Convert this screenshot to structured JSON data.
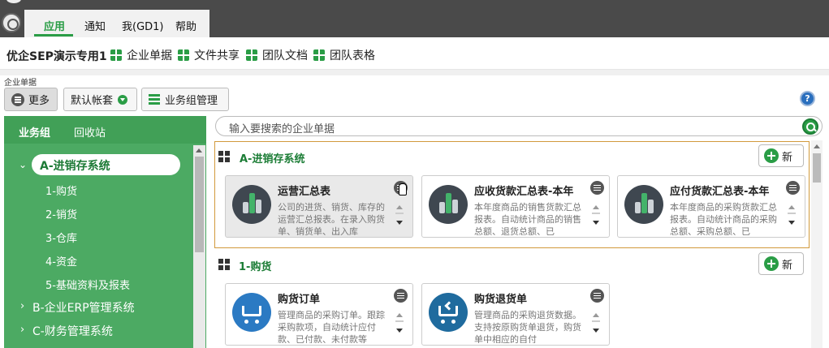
{
  "menu": {
    "items": [
      "应用",
      "通知",
      "我(GD1)",
      "帮助"
    ]
  },
  "workspace": {
    "title": "优企SEP演示专用1",
    "quick": [
      "企业单据",
      "文件共享",
      "团队文档",
      "团队表格"
    ]
  },
  "toolbar": {
    "breadcrumb": "企业单据",
    "more": "更多",
    "account": "默认帐套",
    "group_manage": "业务组管理",
    "help": "?"
  },
  "sidebar": {
    "tabs": [
      "业务组",
      "回收站"
    ],
    "selected": "A-进销存系统",
    "children": [
      "1-购货",
      "2-销货",
      "3-仓库",
      "4-资金",
      "5-基础资料及报表"
    ],
    "groups": [
      "B-企业ERP管理系统",
      "C-财务管理系统"
    ]
  },
  "search": {
    "placeholder": "输入要搜索的企业单据"
  },
  "sections": [
    {
      "title": "A-进销存系统",
      "new_label": "新",
      "cards": [
        {
          "title": "运营汇总表",
          "desc": "公司的进货、销货、库存的运营汇总报表。在录入购货单、销货单、出入库"
        },
        {
          "title": "应收货款汇总表-本年",
          "desc": "本年度商品的销售货款汇总报表。自动统计商品的销售总额、退货总额、已"
        },
        {
          "title": "应付货款汇总表-本年",
          "desc": "本年度商品的采购货款汇总报表。自动统计商品的采购总额、采购总额、已"
        }
      ]
    },
    {
      "title": "1-购货",
      "new_label": "新",
      "cards": [
        {
          "title": "购货订单",
          "desc": "管理商品的采购订单。跟踪采购款项，自动统计应付款、已付款、未付款等"
        },
        {
          "title": "购货退货单",
          "desc": "管理商品的采购退货数据。支持按原购货单退货，购货单中相应的自付"
        }
      ]
    }
  ],
  "colors": {
    "accent": "#2a9d46",
    "sidebar": "#4caa63",
    "topbar": "#4a4a4a"
  }
}
